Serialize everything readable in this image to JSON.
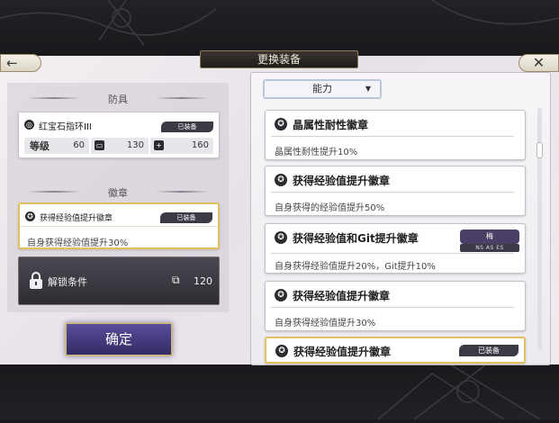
{
  "header": {
    "title": "更换装备",
    "back_icon": "←",
    "close_icon": "✕"
  },
  "armor_section": {
    "title": "防具",
    "item": {
      "name": "红宝石指环III",
      "equipped_tag": "已装备",
      "level_label": "等级",
      "level_value": "60",
      "stat1_value": "130",
      "stat2_value": "160"
    }
  },
  "badge_section": {
    "title": "徽章",
    "item": {
      "name": "获得经验值提升徽章",
      "equipped_tag": "已装备",
      "description": "自身获得经验值提升30%"
    }
  },
  "unlock": {
    "label": "解锁条件",
    "value": "120"
  },
  "confirm_label": "确定",
  "filter": {
    "selected": "能力",
    "arrow": "▼"
  },
  "badge_list": [
    {
      "title": "晶属性耐性徽章",
      "description": "晶属性耐性提升10%"
    },
    {
      "title": "获得经验值提升徽章",
      "description": "自身获得的经验值提升50%"
    },
    {
      "title": "获得经验值和Git提升徽章",
      "description": "自身获得经验值提升20%，Git提升10%",
      "rank": "梅",
      "rank_codes": "NS  AS  ES"
    },
    {
      "title": "获得经验值提升徽章",
      "description": "自身获得经验值提升30%"
    },
    {
      "title": "获得经验值提升徽章",
      "equipped_tag": "已装备"
    }
  ],
  "colors": {
    "accent_gold": "#e2c060",
    "confirm_purple": "#4b3f8a",
    "dark_tag": "#3a3a44"
  }
}
